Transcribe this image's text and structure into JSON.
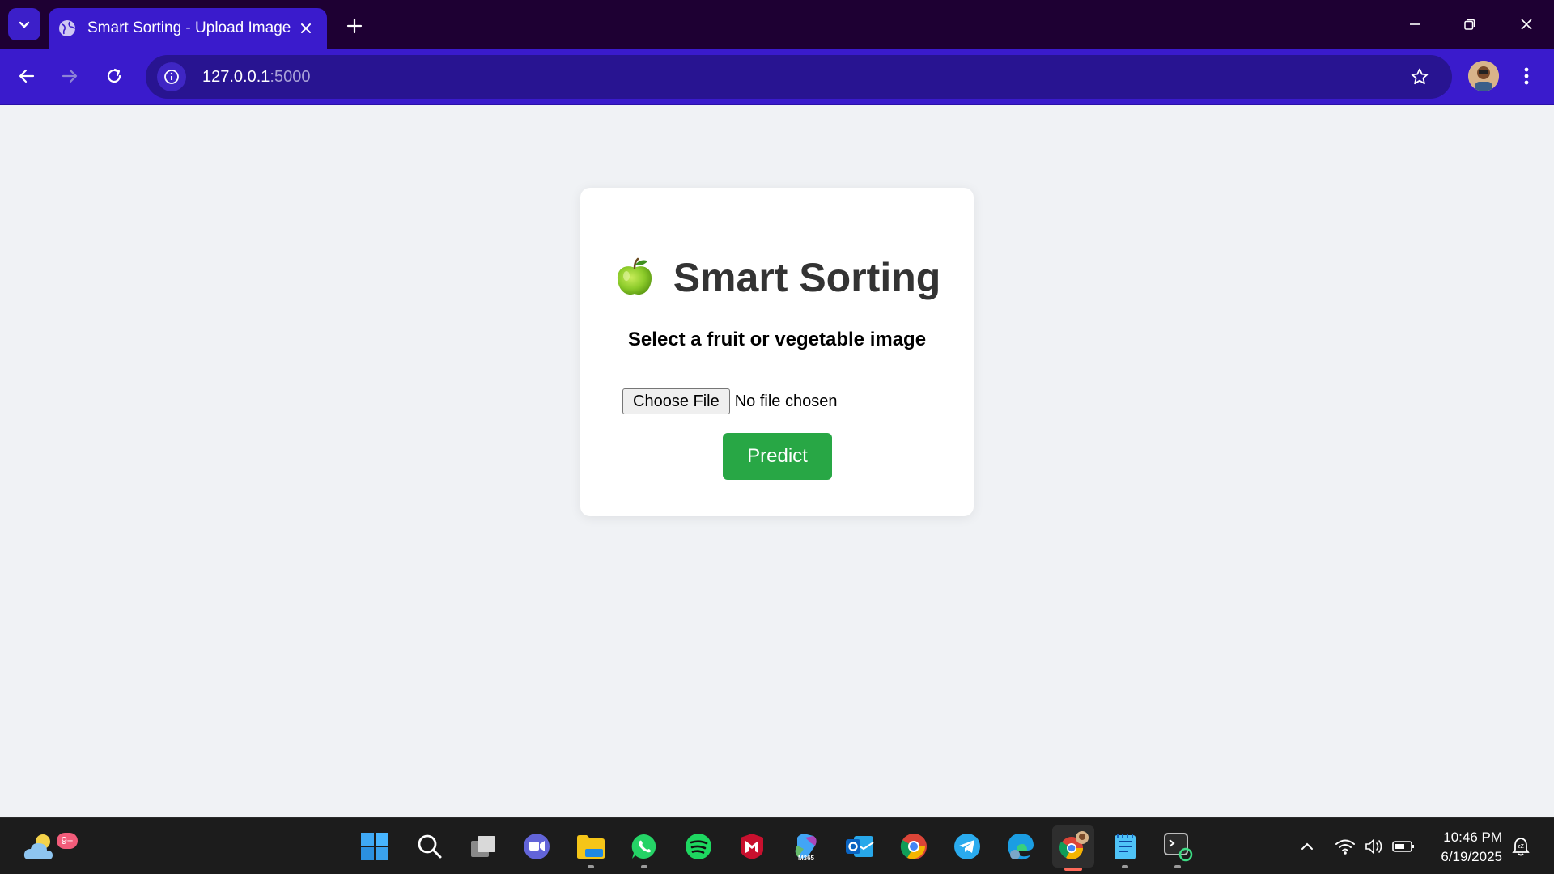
{
  "browser": {
    "tab_title": "Smart Sorting - Upload Image",
    "url_host": "127.0.0.1",
    "url_port": ":5000"
  },
  "page": {
    "heading": "Smart Sorting",
    "subtitle": "Select a fruit or vegetable image",
    "choose_file_label": "Choose File",
    "no_file_text": "No file chosen",
    "predict_label": "Predict",
    "colors": {
      "accent": "#28a745",
      "heading": "#333333",
      "background": "#f0f2f5"
    }
  },
  "taskbar": {
    "weather_badge": "9+",
    "copilot_label": "M365",
    "time": "10:46 PM",
    "date": "6/19/2025",
    "pinned_icons": [
      "start-icon",
      "search-icon",
      "task-view-icon",
      "teams-icon",
      "file-explorer-icon",
      "whatsapp-icon",
      "spotify-icon",
      "mcafee-icon",
      "m365-copilot-icon",
      "outlook-icon",
      "chrome-icon",
      "telegram-icon",
      "edge-icon",
      "chrome-profile-icon",
      "notepad-icon",
      "terminal-icon"
    ]
  }
}
